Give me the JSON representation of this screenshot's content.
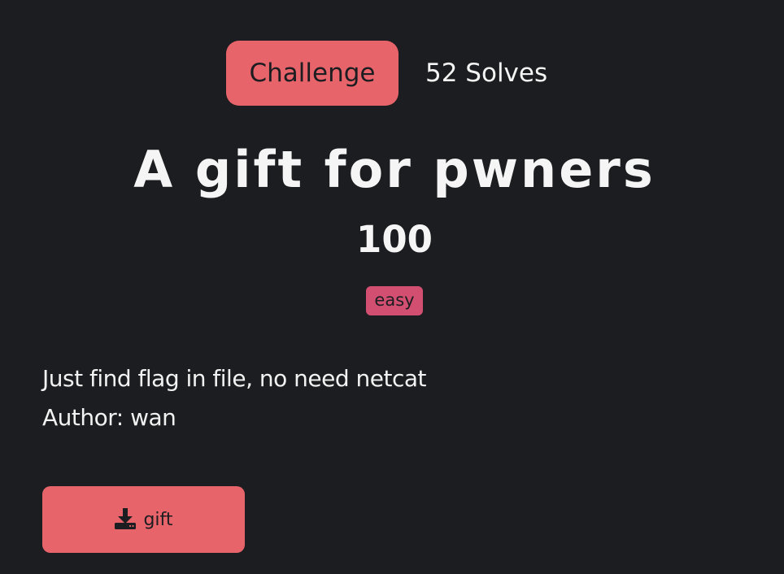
{
  "tabs": {
    "challenge_label": "Challenge",
    "solves_label": "52 Solves"
  },
  "challenge": {
    "name": "A gift for pwners",
    "points": "100",
    "difficulty": "easy",
    "description_lines": [
      "Just find flag in file, no need netcat",
      "Author: wan"
    ]
  },
  "files": [
    {
      "label": "gift",
      "icon": "download-icon"
    }
  ],
  "colors": {
    "background": "#1c1d20",
    "accent": "#e8646b",
    "badge": "#d24f72",
    "text": "#f2f2f2"
  }
}
